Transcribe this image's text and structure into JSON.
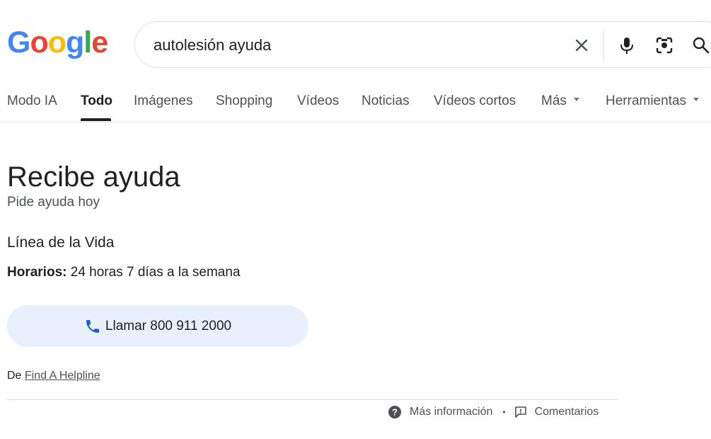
{
  "logo": {
    "letters": [
      "G",
      "o",
      "o",
      "g",
      "l",
      "e"
    ],
    "colors": [
      "#4285F4",
      "#EA4335",
      "#FBBC05",
      "#4285F4",
      "#34A853",
      "#EA4335"
    ]
  },
  "search": {
    "value": "autolesión ayuda",
    "icons": [
      "close-icon",
      "mic-icon",
      "lens-icon",
      "search-icon"
    ]
  },
  "tabs": [
    {
      "label": "Modo IA"
    },
    {
      "label": "Todo",
      "active": true
    },
    {
      "label": "Imágenes"
    },
    {
      "label": "Shopping"
    },
    {
      "label": "Vídeos"
    },
    {
      "label": "Noticias"
    },
    {
      "label": "Vídeos cortos"
    },
    {
      "label": "Más",
      "dropdown": true
    },
    {
      "label": "Herramientas",
      "dropdown": true
    }
  ],
  "help": {
    "title": "Recibe ayuda",
    "subtitle": "Pide ayuda hoy",
    "organization": "Línea de la Vida",
    "hours_label": "Horarios:",
    "hours_value": " 24 horas 7 días a la semana",
    "call_label": "Llamar 800 911 2000",
    "source_prefix": "De ",
    "source_link": "Find A Helpline"
  },
  "footer": {
    "more_info": "Más información",
    "separator": "•",
    "feedback": "Comentarios"
  },
  "colors": {
    "accent_blue": "#1a73e8",
    "call_bg": "#e8f0fe"
  }
}
